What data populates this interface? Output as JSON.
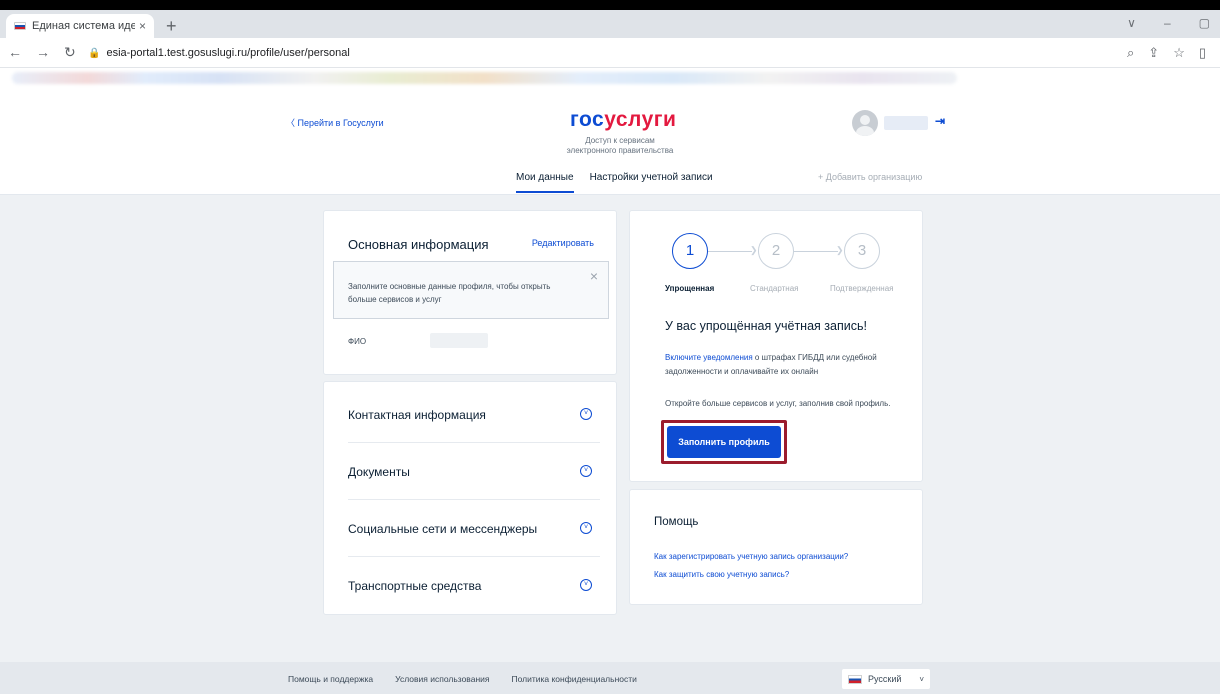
{
  "browser": {
    "tab_title": "Единая система идентификаци",
    "tab_close": "×",
    "new_tab": "+",
    "url": "esia-portal1.test.gosuslugi.ru/profile/user/personal",
    "window_controls": [
      "∨",
      "–",
      "▢"
    ]
  },
  "header": {
    "back_link": "〈 Перейти в Госуслуги",
    "logo_part1": "гос",
    "logo_part2": "услуги",
    "tagline": "Доступ к сервисам электронного правительства",
    "nav": [
      {
        "label": "Мои данные",
        "active": true
      },
      {
        "label": "Настройки учетной записи",
        "active": false
      }
    ],
    "add_org": "+ Добавить организацию"
  },
  "basic_info": {
    "title": "Основная информация",
    "edit": "Редактировать",
    "notice": "Заполните основные данные профиля, чтобы открыть больше сервисов и услуг",
    "fio_label": "ФИО"
  },
  "accordion": [
    {
      "label": "Контактная информация"
    },
    {
      "label": "Документы"
    },
    {
      "label": "Социальные сети и мессенджеры"
    },
    {
      "label": "Транспортные средства"
    }
  ],
  "status": {
    "steps": [
      {
        "num": "1",
        "label": "Упрощенная",
        "active": true
      },
      {
        "num": "2",
        "label": "Стандартная",
        "active": false
      },
      {
        "num": "3",
        "label": "Подтвержденная",
        "active": false
      }
    ],
    "title": "У вас упрощённая учётная запись!",
    "text1_link": "Включите уведомления",
    "text1_rest": " о штрафах ГИБДД или судебной задолженности и оплачивайте их онлайн",
    "text2": "Откройте больше сервисов и услуг, заполнив свой профиль.",
    "cta": "Заполнить профиль"
  },
  "help": {
    "title": "Помощь",
    "links": [
      "Как зарегистрировать учетную запись организации?",
      "Как защитить свою учетную запись?"
    ]
  },
  "footer": {
    "links": [
      "Помощь и поддержка",
      "Условия использования",
      "Политика конфиденциальности"
    ],
    "language": "Русский"
  },
  "colors": {
    "brand_blue": "#0d4cd3",
    "brand_red": "#e3193f",
    "highlight_frame": "#9b1c2d"
  }
}
